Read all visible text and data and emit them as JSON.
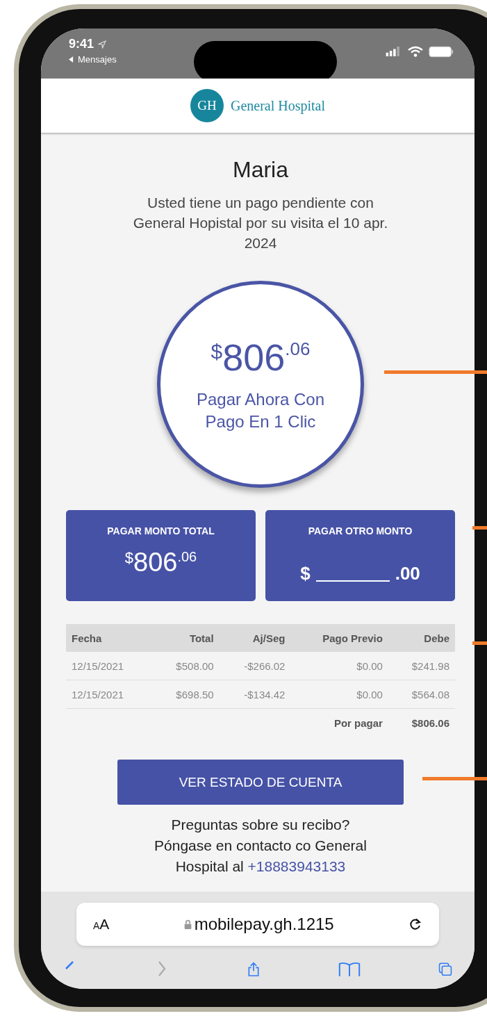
{
  "status_bar": {
    "time": "9:41",
    "back_label": "Mensajes"
  },
  "header": {
    "logo_initials": "GH",
    "name": "General Hospital"
  },
  "greeting": "Maria",
  "message": "Usted tiene un pago pendiente con General Hopistal por su visita el 10 apr. 2024",
  "pay_circle": {
    "currency": "$",
    "whole": "806",
    "cents": ".06",
    "label": "Pagar Ahora Con Pago En 1 Clic"
  },
  "cards": [
    {
      "kind": "amount",
      "title": "PAGAR MONTO TOTAL",
      "currency": "$",
      "whole": "806",
      "cents": ".06"
    },
    {
      "kind": "input",
      "title": "PAGAR OTRO MONTO",
      "currency": "$",
      "cents": ".00"
    }
  ],
  "table": {
    "columns": [
      "Fecha",
      "Total",
      "Aj/Seg",
      "Pago Previo",
      "Debe"
    ],
    "rows": [
      [
        "12/15/2021",
        "$508.00",
        "-$266.02",
        "$0.00",
        "$241.98"
      ],
      [
        "12/15/2021",
        "$698.50",
        "-$134.42",
        "$0.00",
        "$564.08"
      ]
    ],
    "footer": {
      "label": "Por pagar",
      "value": "$806.06"
    }
  },
  "statement_button": "VER ESTADO DE CUENTA",
  "contact": {
    "text": "Preguntas sobre su recibo? Póngase en contacto co General Hospital al",
    "phone": "+18883943133"
  },
  "browser": {
    "text_size": "AA",
    "url": "mobilepay.gh.1215"
  }
}
